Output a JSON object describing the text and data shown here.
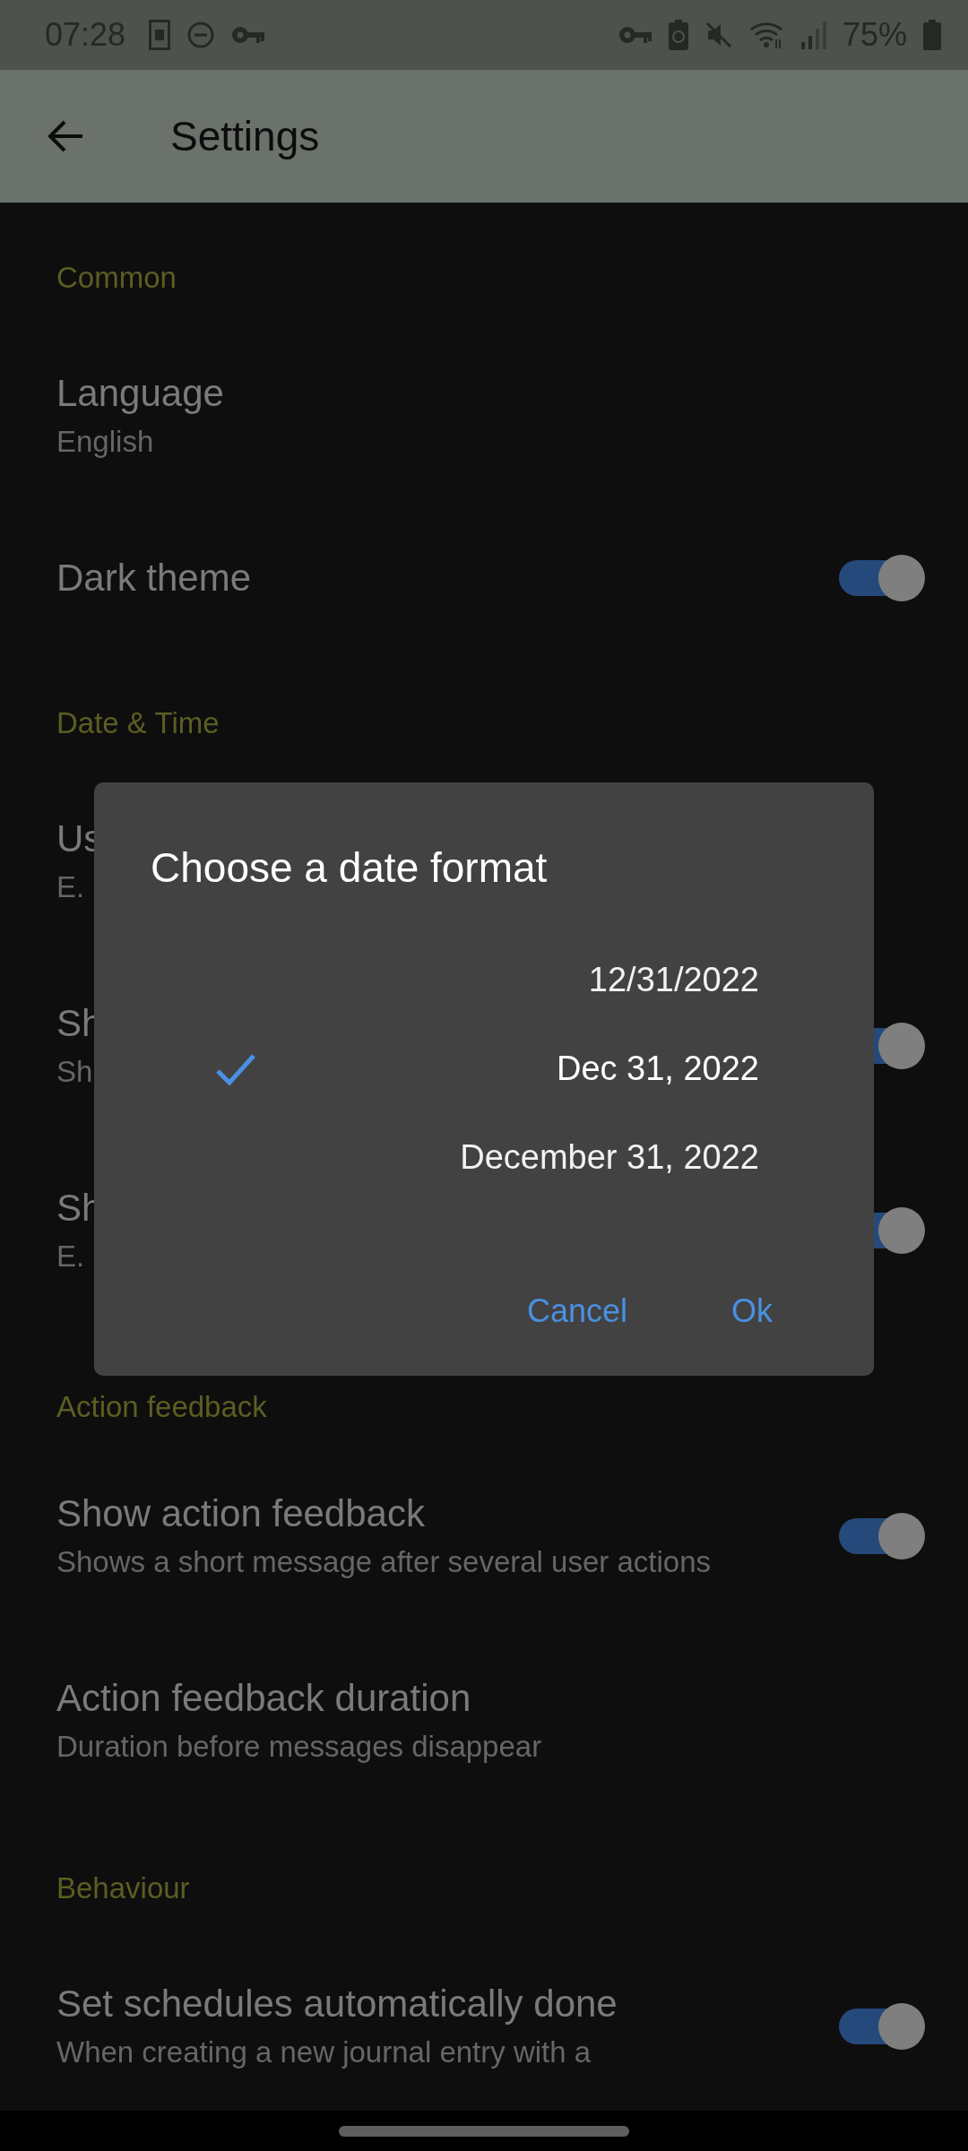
{
  "status_bar": {
    "time": "07:28",
    "battery": "75%"
  },
  "app_bar": {
    "title": "Settings"
  },
  "sections": [
    {
      "header": "Common",
      "items": [
        {
          "kind": "text",
          "title": "Language",
          "subtitle": "English"
        },
        {
          "kind": "switch",
          "title": "Dark theme",
          "on": true
        }
      ]
    },
    {
      "header": "Date & Time",
      "items": [
        {
          "kind": "text",
          "title": "Us",
          "subtitle": "E."
        },
        {
          "kind": "switch",
          "title": "Sh",
          "subtitle": "Sh",
          "on": true
        },
        {
          "kind": "switch",
          "title": "Sh",
          "subtitle": "E.",
          "on": true
        }
      ]
    },
    {
      "header": "Action feedback",
      "items": [
        {
          "kind": "switch",
          "title": "Show action feedback",
          "subtitle": "Shows a short message after several user actions",
          "on": true
        },
        {
          "kind": "text",
          "title": "Action feedback duration",
          "subtitle": "Duration before messages disappear"
        }
      ]
    },
    {
      "header": "Behaviour",
      "items": [
        {
          "kind": "switch",
          "title": "Set schedules automatically done",
          "subtitle": "When creating a new journal entry with a",
          "on": true
        }
      ]
    }
  ],
  "dialog": {
    "title": "Choose a date format",
    "options": [
      {
        "label": "12/31/2022",
        "selected": false
      },
      {
        "label": "Dec 31, 2022",
        "selected": true
      },
      {
        "label": "December 31, 2022",
        "selected": false
      }
    ],
    "buttons": [
      "Cancel",
      "Ok"
    ]
  }
}
